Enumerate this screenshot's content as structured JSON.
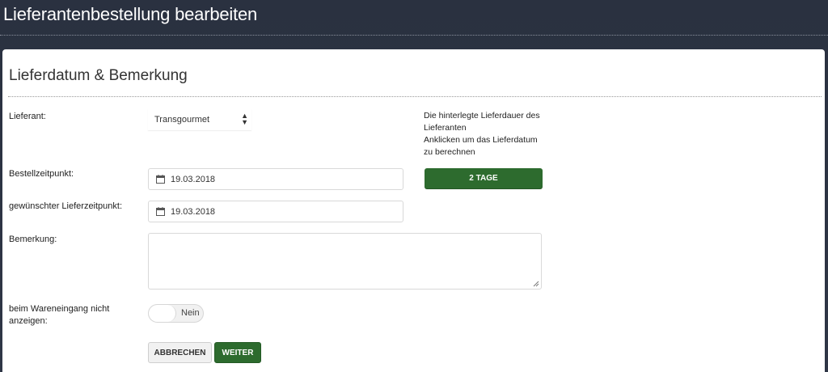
{
  "header": {
    "title": "Lieferantenbestellung bearbeiten"
  },
  "section": {
    "title": "Lieferdatum & Bemerkung"
  },
  "form": {
    "supplier": {
      "label": "Lieferant:",
      "value": "Transgourmet"
    },
    "order_time": {
      "label": "Bestellzeitpunkt:",
      "value": "19.03.2018"
    },
    "delivery_time": {
      "label": "gewünschter Lieferzeitpunkt:",
      "value": "19.03.2018"
    },
    "remark": {
      "label": "Bemerkung:",
      "value": ""
    },
    "hide_on_receipt": {
      "label_line1": "beim Wareneingang nicht",
      "label_line2": "anzeigen:",
      "value": "Nein"
    }
  },
  "hint": {
    "line1": "Die hinterlegte Lieferdauer des",
    "line2": "Lieferanten",
    "line3": "Anklicken um das Lieferdatum",
    "line4": "zu berechnen"
  },
  "buttons": {
    "days": "2 TAGE",
    "cancel": "ABBRECHEN",
    "next": "WEITER"
  },
  "colors": {
    "header_bg": "#2a3140",
    "accent_green": "#2d6b2e"
  },
  "icons": {
    "date": "calendar-icon",
    "select": "sort-arrows-icon",
    "resize": "resize-grip-icon"
  }
}
